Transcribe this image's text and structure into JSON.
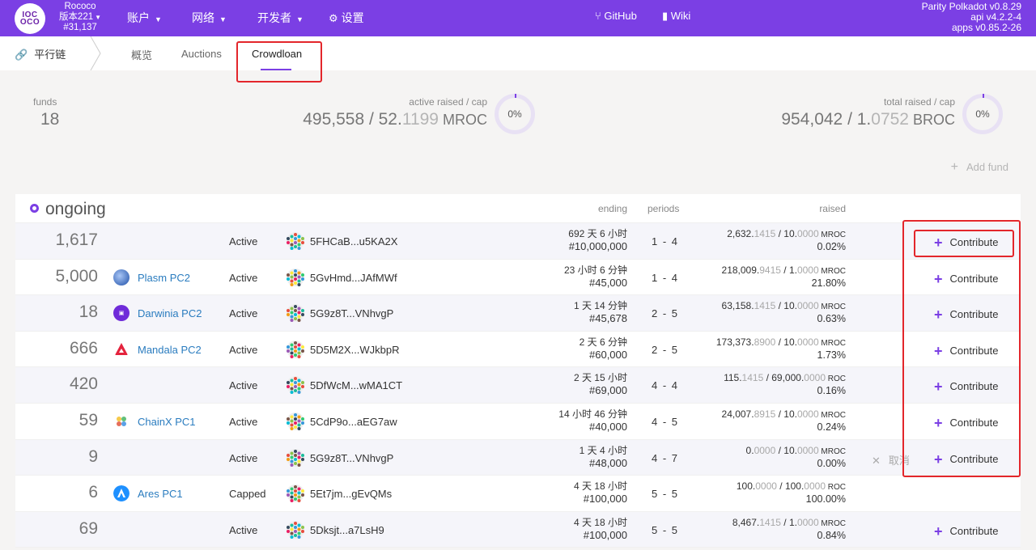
{
  "topbar": {
    "logo_line1": "ΙΟC",
    "logo_line2": "ΟCΟ",
    "chain_name": "Rococo",
    "version_label": "版本221",
    "block_number": "#31,137",
    "menu": [
      {
        "label": "账户"
      },
      {
        "label": "网络"
      },
      {
        "label": "开发者"
      },
      {
        "label": "设置"
      }
    ],
    "links": [
      {
        "label": "GitHub"
      },
      {
        "label": "Wiki"
      }
    ],
    "versions": [
      "Parity Polkadot v0.8.29",
      "api v4.2.2-4",
      "apps v0.85.2-26"
    ]
  },
  "subnav": {
    "section": "平行链",
    "tabs": [
      {
        "label": "概览"
      },
      {
        "label": "Auctions"
      },
      {
        "label": "Crowdloan"
      }
    ]
  },
  "summary": {
    "funds_label": "funds",
    "funds_value": "18",
    "active_label": "active raised / cap",
    "active_int": "495,558 / 52.",
    "active_dec": "1199",
    "active_unit": " MROC",
    "active_pct": "0%",
    "total_label": "total raised / cap",
    "total_int": "954,042 / 1.",
    "total_dec": "0752",
    "total_unit": " BROC",
    "total_pct": "0%",
    "add_fund": "Add fund"
  },
  "table": {
    "section": "ongoing",
    "headers": {
      "ending": "ending",
      "periods": "periods",
      "raised": "raised"
    },
    "contribute_label": "Contribute",
    "cancel_label": "取消",
    "rows": [
      {
        "id": "1,617",
        "project": "",
        "status": "Active",
        "address": "5FHCaB...u5KA2X",
        "ending": "692 天 6 小时",
        "block": "#10,000,000",
        "periods": "1 - 4",
        "raised_int": "2,632.",
        "raised_dec": "1415",
        "cap_int": " / 10.",
        "cap_dec": "0000",
        "unit": " MROC",
        "pct": "0.02%",
        "contribute": true,
        "cancel": false
      },
      {
        "id": "5,000",
        "project": "Plasm PC2",
        "status": "Active",
        "address": "5GvHmd...JAfMWf",
        "ending": "23 小时 6 分钟",
        "block": "#45,000",
        "periods": "1 - 4",
        "raised_int": "218,009.",
        "raised_dec": "9415",
        "cap_int": " / 1.",
        "cap_dec": "0000",
        "unit": " MROC",
        "pct": "21.80%",
        "contribute": true,
        "cancel": false
      },
      {
        "id": "18",
        "project": "Darwinia PC2",
        "status": "Active",
        "address": "5G9z8T...VNhvgP",
        "ending": "1 天 14 分钟",
        "block": "#45,678",
        "periods": "2 - 5",
        "raised_int": "63,158.",
        "raised_dec": "1415",
        "cap_int": " / 10.",
        "cap_dec": "0000",
        "unit": " MROC",
        "pct": "0.63%",
        "contribute": true,
        "cancel": false
      },
      {
        "id": "666",
        "project": "Mandala PC2",
        "status": "Active",
        "address": "5D5M2X...WJkbpR",
        "ending": "2 天 6 分钟",
        "block": "#60,000",
        "periods": "2 - 5",
        "raised_int": "173,373.",
        "raised_dec": "8900",
        "cap_int": " / 10.",
        "cap_dec": "0000",
        "unit": " MROC",
        "pct": "1.73%",
        "contribute": true,
        "cancel": false
      },
      {
        "id": "420",
        "project": "",
        "status": "Active",
        "address": "5DfWcM...wMA1CT",
        "ending": "2 天 15 小时",
        "block": "#69,000",
        "periods": "4 - 4",
        "raised_int": "115.",
        "raised_dec": "1415",
        "cap_int": " / 69,000.",
        "cap_dec": "0000",
        "unit": " ROC",
        "pct": "0.16%",
        "contribute": true,
        "cancel": false
      },
      {
        "id": "59",
        "project": "ChainX PC1",
        "status": "Active",
        "address": "5CdP9o...aEG7aw",
        "ending": "14 小时 46 分钟",
        "block": "#40,000",
        "periods": "4 - 5",
        "raised_int": "24,007.",
        "raised_dec": "8915",
        "cap_int": " / 10.",
        "cap_dec": "0000",
        "unit": " MROC",
        "pct": "0.24%",
        "contribute": true,
        "cancel": false
      },
      {
        "id": "9",
        "project": "",
        "status": "Active",
        "address": "5G9z8T...VNhvgP",
        "ending": "1 天 4 小时",
        "block": "#48,000",
        "periods": "4 - 7",
        "raised_int": "0.",
        "raised_dec": "0000",
        "cap_int": " / 10.",
        "cap_dec": "0000",
        "unit": " MROC",
        "pct": "0.00%",
        "contribute": true,
        "cancel": true
      },
      {
        "id": "6",
        "project": "Ares PC1",
        "status": "Capped",
        "address": "5Et7jm...gEvQMs",
        "ending": "4 天 18 小时",
        "block": "#100,000",
        "periods": "5 - 5",
        "raised_int": "100.",
        "raised_dec": "0000",
        "cap_int": " / 100.",
        "cap_dec": "0000",
        "unit": " ROC",
        "pct": "100.00%",
        "contribute": false,
        "cancel": false
      },
      {
        "id": "69",
        "project": "",
        "status": "Active",
        "address": "5Dksjt...a7LsH9",
        "ending": "4 天 18 小时",
        "block": "#100,000",
        "periods": "5 - 5",
        "raised_int": "8,467.",
        "raised_dec": "1415",
        "cap_int": " / 1.",
        "cap_dec": "0000",
        "unit": " MROC",
        "pct": "0.84%",
        "contribute": true,
        "cancel": false
      }
    ]
  },
  "colors": {
    "brand": "#7b3fe4",
    "highlight": "#e3262b",
    "link": "#2a7cbf"
  }
}
